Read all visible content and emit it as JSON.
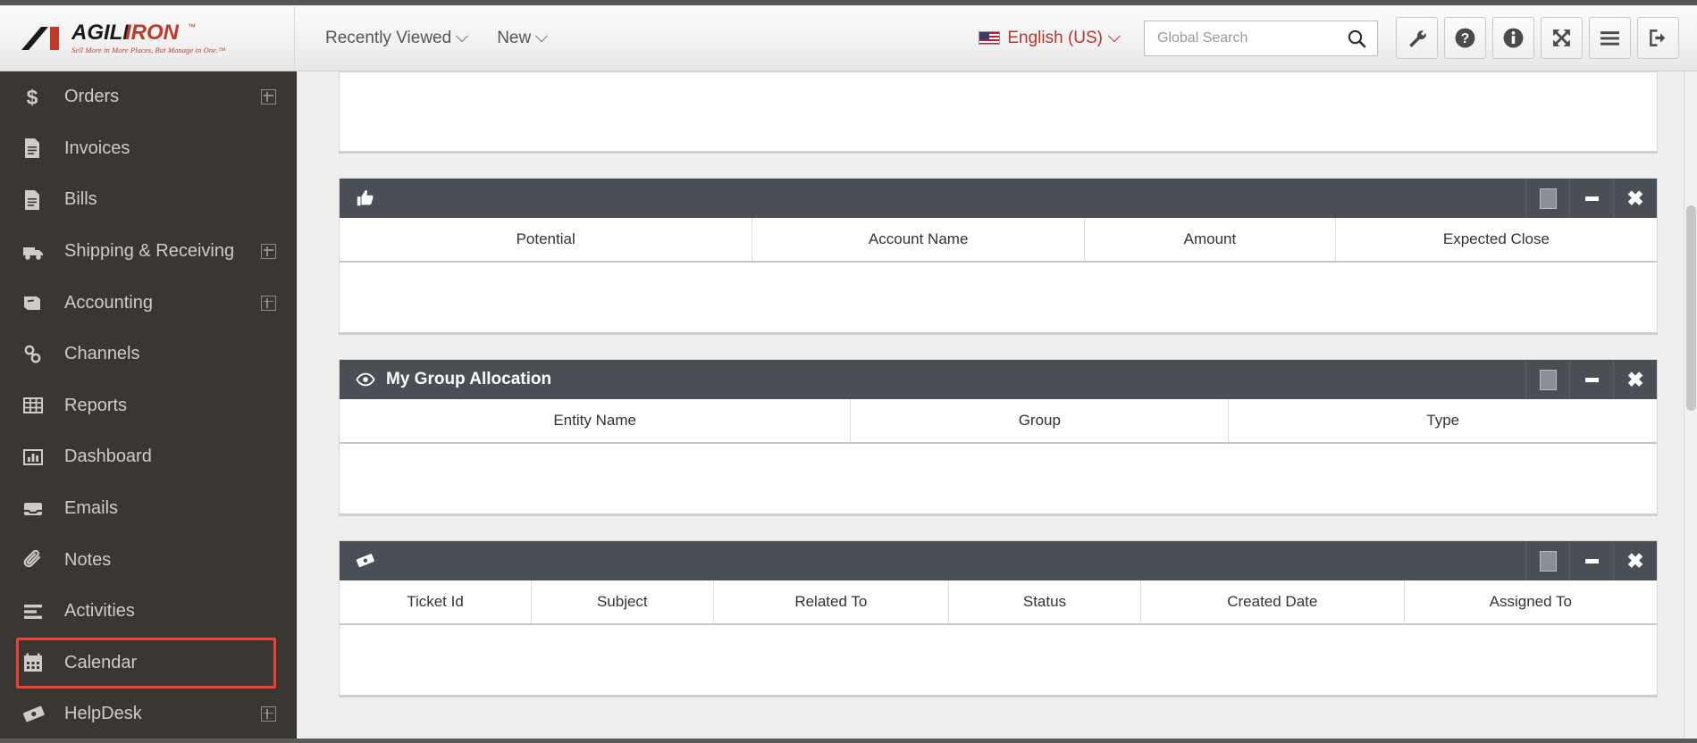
{
  "header": {
    "logo_word": "AGILIRON",
    "logo_trademark": "™",
    "logo_tagline": "Sell More in More Places, But Manage in One.™",
    "nav": [
      {
        "label": "Recently Viewed",
        "icon": "chevron-down-icon"
      },
      {
        "label": "New",
        "icon": "chevron-down-icon"
      }
    ],
    "language": {
      "label": "English (US)",
      "icon": "us-flag-icon",
      "color": "#b5382f"
    },
    "search": {
      "placeholder": "Global Search",
      "value": "",
      "icon": "search-icon"
    },
    "icon_buttons": [
      {
        "name": "wrench-icon",
        "title": "Settings"
      },
      {
        "name": "question-circle-icon",
        "title": "Help"
      },
      {
        "name": "info-circle-icon",
        "title": "Info"
      },
      {
        "name": "expand-arrows-icon",
        "title": "Fullscreen"
      },
      {
        "name": "hamburger-menu-icon",
        "title": "Menu"
      },
      {
        "name": "logout-icon",
        "title": "Sign Out"
      }
    ]
  },
  "sidebar": {
    "background": "#3a3632",
    "highlight_color": "#ef4136",
    "items": [
      {
        "label": "Orders",
        "icon": "dollar-icon",
        "expandable": true,
        "highlighted": false
      },
      {
        "label": "Invoices",
        "icon": "document-lines-icon",
        "expandable": false,
        "highlighted": false
      },
      {
        "label": "Bills",
        "icon": "document-lines-icon",
        "expandable": false,
        "highlighted": false
      },
      {
        "label": "Shipping & Receiving",
        "icon": "truck-icon",
        "expandable": true,
        "highlighted": false
      },
      {
        "label": "Accounting",
        "icon": "ledger-book-icon",
        "expandable": true,
        "highlighted": false
      },
      {
        "label": "Channels",
        "icon": "link-chain-icon",
        "expandable": false,
        "highlighted": false
      },
      {
        "label": "Reports",
        "icon": "table-grid-icon",
        "expandable": false,
        "highlighted": false
      },
      {
        "label": "Dashboard",
        "icon": "bar-chart-icon",
        "expandable": false,
        "highlighted": false
      },
      {
        "label": "Emails",
        "icon": "inbox-tray-icon",
        "expandable": false,
        "highlighted": false
      },
      {
        "label": "Notes",
        "icon": "paperclip-icon",
        "expandable": false,
        "highlighted": false
      },
      {
        "label": "Activities",
        "icon": "list-lines-icon",
        "expandable": false,
        "highlighted": false
      },
      {
        "label": "Calendar",
        "icon": "calendar-icon",
        "expandable": false,
        "highlighted": true
      },
      {
        "label": "HelpDesk",
        "icon": "ticket-icon",
        "expandable": true,
        "highlighted": false
      }
    ]
  },
  "main": {
    "panel_controls": {
      "maximize_label": "",
      "minimize_label": "",
      "close_label": "✖"
    },
    "panels": [
      {
        "id": "panel-top-partial",
        "title": "",
        "icon": "",
        "has_header": false,
        "columns": [],
        "rows": []
      },
      {
        "id": "panel-potentials",
        "title": "",
        "icon": "thumbs-up-icon",
        "has_header": true,
        "columns": [
          "Potential",
          "Account Name",
          "Amount",
          "Expected Close"
        ],
        "rows": []
      },
      {
        "id": "panel-my-group-allocation",
        "title": "My Group Allocation",
        "icon": "eye-icon",
        "has_header": true,
        "columns": [
          "Entity Name",
          "Group",
          "Type"
        ],
        "rows": []
      },
      {
        "id": "panel-tickets",
        "title": "",
        "icon": "ticket-icon",
        "has_header": true,
        "columns": [
          "Ticket Id",
          "Subject",
          "Related To",
          "Status",
          "Created Date",
          "Assigned To"
        ],
        "rows": []
      }
    ]
  }
}
